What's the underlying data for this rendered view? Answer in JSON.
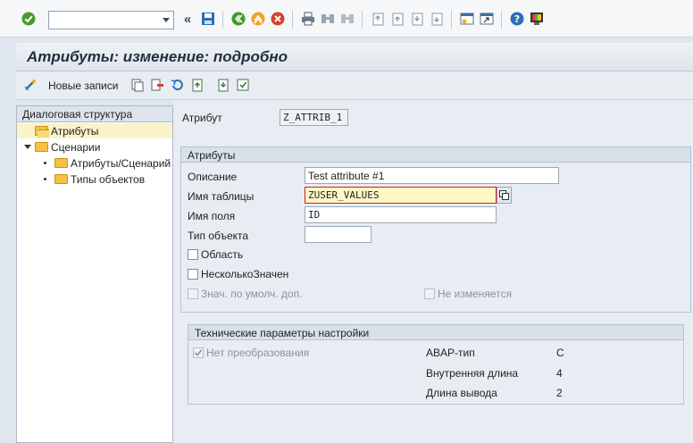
{
  "toolbar": {
    "command_field": {
      "value": "",
      "placeholder": ""
    }
  },
  "title": "Атрибуты: изменение: подробно",
  "app_toolbar": {
    "new_entries_label": "Новые записи"
  },
  "tree": {
    "header": "Диалоговая структура",
    "items": [
      {
        "label": "Атрибуты",
        "level": 1,
        "selected": true
      },
      {
        "label": "Сценарии",
        "level": 1,
        "expanded": true
      },
      {
        "label": "Атрибуты/Сценарий",
        "level": 2
      },
      {
        "label": "Типы объектов",
        "level": 2
      }
    ]
  },
  "header_field": {
    "label": "Атрибут",
    "value": "Z_ATTRIB_1"
  },
  "attributes_group": {
    "title": "Атрибуты",
    "description": {
      "label": "Описание",
      "value": "Test attribute #1"
    },
    "table_name": {
      "label": "Имя таблицы",
      "value": "ZUSER_VALUES"
    },
    "field_name": {
      "label": "Имя поля",
      "value": "ID"
    },
    "object_type": {
      "label": "Тип объекта",
      "value": ""
    },
    "area_checkbox": {
      "label": "Область",
      "checked": false
    },
    "multi_values_checkbox": {
      "label": "НесколькоЗначен",
      "checked": false
    },
    "default_value_checkbox": {
      "label": "Знач. по умолч. доп.",
      "checked": false,
      "disabled": true
    },
    "unchangeable_checkbox": {
      "label": "Не изменяется",
      "checked": false,
      "disabled": true
    }
  },
  "tech_group": {
    "title": "Технические параметры настройки",
    "no_conversion_checkbox": {
      "label": "Нет преобразования",
      "checked": true,
      "disabled": true
    },
    "abap_type": {
      "label": "ABAP-тип",
      "value": "C"
    },
    "internal_length": {
      "label": "Внутренняя длина",
      "value": "4"
    },
    "output_length": {
      "label": "Длина вывода",
      "value": "2"
    }
  }
}
